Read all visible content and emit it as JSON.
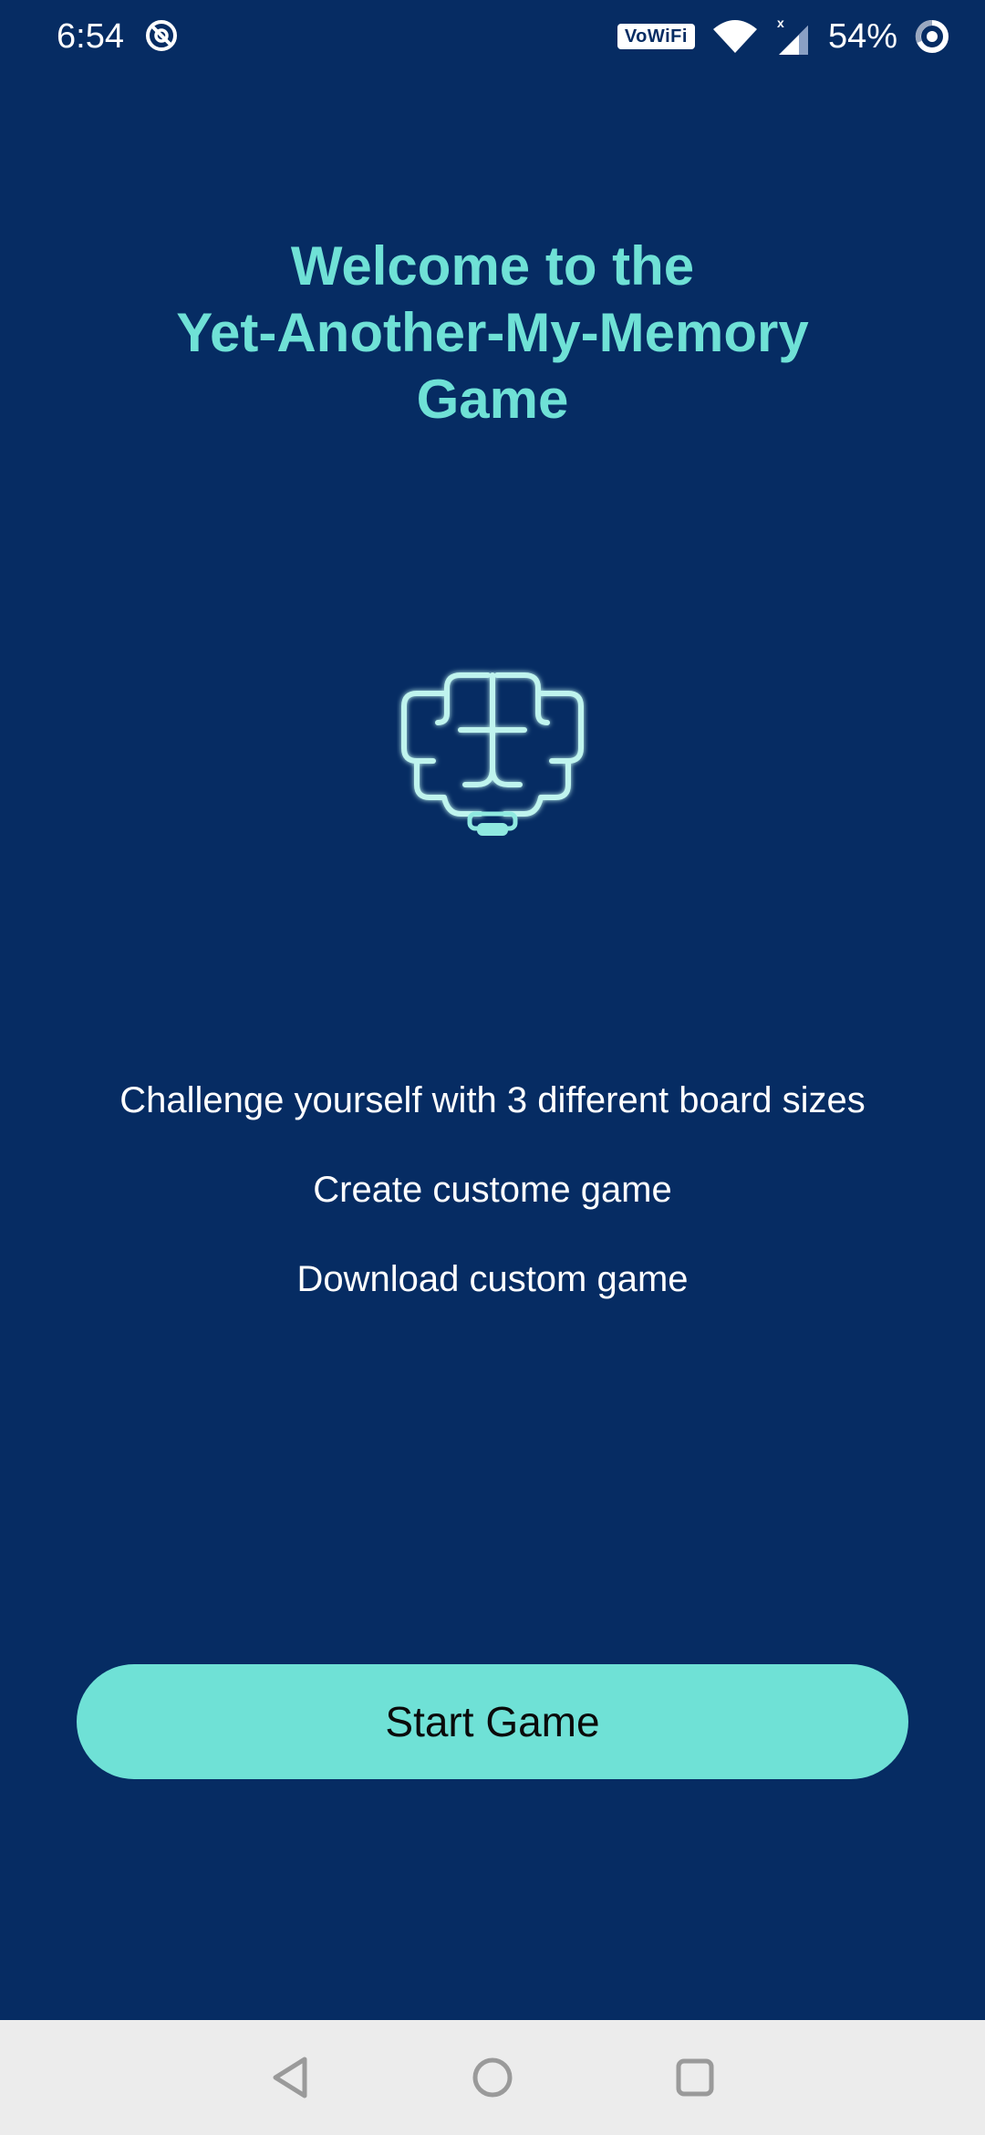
{
  "status_bar": {
    "time": "6:54",
    "app_icon": "no-disturb-icon",
    "vowifi_label": "VoWiFi",
    "wifi_icon": "wifi-icon",
    "signal_icon": "cell-signal-icon",
    "battery_percent": "54%",
    "battery_icon": "battery-ring-icon"
  },
  "welcome": {
    "title_line1": "Welcome to the",
    "title_line2": "Yet-Another-My-Memory",
    "title_line3": "Game",
    "title_color": "#6fe1d6"
  },
  "logo": {
    "icon": "brain-icon"
  },
  "features": [
    "Challenge yourself with 3 different board sizes",
    "Create custome game",
    "Download custom game"
  ],
  "start_button": {
    "label": "Start Game",
    "color": "#6fe1d6"
  },
  "nav_bar": {
    "back_icon": "back-triangle-icon",
    "home_icon": "home-circle-icon",
    "recents_icon": "recents-square-icon"
  },
  "colors": {
    "background": "#062c63",
    "accent": "#6fe1d6",
    "nav_background": "#ececec"
  }
}
